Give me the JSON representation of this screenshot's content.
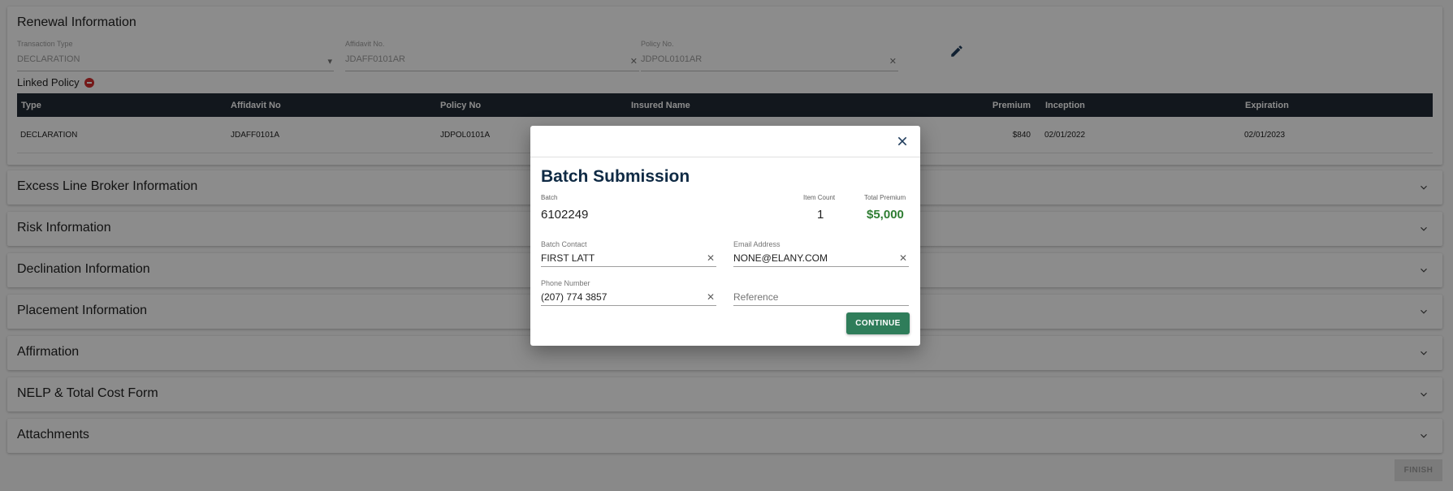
{
  "renewal": {
    "title": "Renewal Information",
    "transaction_type": {
      "label": "Transaction Type",
      "value": "DECLARATION"
    },
    "affidavit_no": {
      "label": "Affidavit No.",
      "value": "JDAFF0101AR"
    },
    "policy_no": {
      "label": "Policy No.",
      "value": "JDPOL0101AR"
    },
    "linked_policy_label": "Linked Policy",
    "table": {
      "headers": [
        "Type",
        "Affidavit No",
        "Policy No",
        "Insured Name",
        "Premium",
        "Inception",
        "Expiration"
      ],
      "rows": [
        [
          "DECLARATION",
          "JDAFF0101A",
          "JDPOL0101A",
          "",
          "$840",
          "02/01/2022",
          "02/01/2023"
        ]
      ]
    }
  },
  "sections": [
    "Excess Line Broker Information",
    "Risk Information",
    "Declination Information",
    "Placement Information",
    "Affirmation",
    "NELP & Total Cost Form",
    "Attachments"
  ],
  "finish_label": "FINISH",
  "modal": {
    "title": "Batch Submission",
    "batch_label": "Batch",
    "batch_value": "6102249",
    "item_count_label": "Item Count",
    "item_count_value": "1",
    "total_premium_label": "Total Premium",
    "total_premium_value": "$5,000",
    "batch_contact": {
      "label": "Batch Contact",
      "value": "FIRST LATT"
    },
    "email": {
      "label": "Email Address",
      "value": "NONE@ELANY.COM"
    },
    "phone": {
      "label": "Phone Number",
      "value": "(207) 774 3857"
    },
    "reference": {
      "placeholder": "Reference"
    },
    "continue_label": "CONTINUE"
  },
  "colors": {
    "table_header": "#212b36",
    "premium_green": "#2e7d32",
    "continue_button": "#2f7d5a",
    "remove_icon": "#d32f2f",
    "title_navy": "#0f2a44"
  }
}
